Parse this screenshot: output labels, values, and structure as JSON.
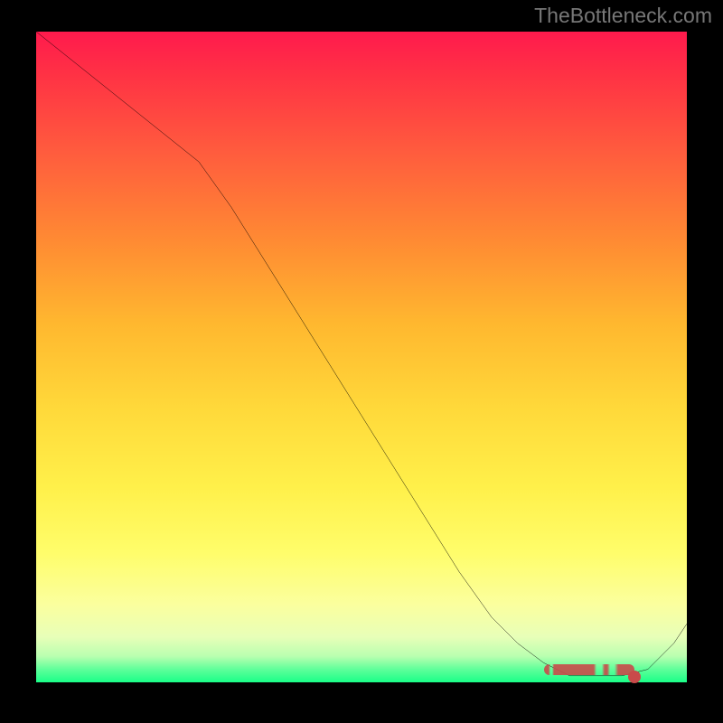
{
  "attribution": "TheBottleneck.com",
  "chart_data": {
    "type": "line",
    "title": "",
    "xlabel": "",
    "ylabel": "",
    "xlim": [
      0,
      100
    ],
    "ylim": [
      0,
      100
    ],
    "x": [
      0,
      5,
      10,
      15,
      20,
      25,
      30,
      35,
      40,
      45,
      50,
      55,
      60,
      65,
      70,
      74,
      78,
      82,
      86,
      90,
      94,
      98,
      100
    ],
    "values": [
      100,
      96,
      92,
      88,
      84,
      80,
      73,
      65,
      57,
      49,
      41,
      33,
      25,
      17,
      10,
      6,
      3,
      1,
      1,
      1,
      2,
      6,
      9
    ],
    "markers_x": [
      78,
      80,
      82,
      84,
      86,
      88,
      90,
      92
    ],
    "markers_y": [
      1.2,
      1.2,
      1.2,
      1.1,
      1.1,
      1.1,
      1.3,
      1.5
    ],
    "background_gradient": {
      "top": "#ff1a4d",
      "mid1": "#ffb82f",
      "mid2": "#fff04a",
      "bottom": "#1aff88"
    }
  }
}
